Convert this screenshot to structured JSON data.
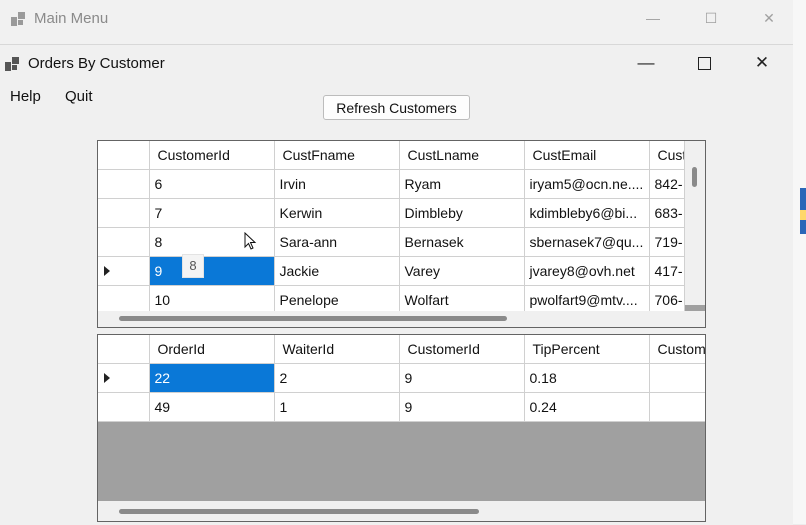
{
  "main_menu_window": {
    "title": "Main Menu"
  },
  "window": {
    "title": "Orders By Customer"
  },
  "menu": [
    "Help",
    "Quit"
  ],
  "refresh_button": "Refresh Customers",
  "customers_grid": {
    "columns": [
      "CustomerId",
      "CustFname",
      "CustLname",
      "CustEmail",
      "Cust"
    ],
    "rows": [
      {
        "id": "6",
        "fname": "Irvin",
        "lname": "Ryam",
        "email": "iryam5@ocn.ne....",
        "phone": "842-"
      },
      {
        "id": "7",
        "fname": "Kerwin",
        "lname": "Dimbleby",
        "email": "kdimbleby6@bi...",
        "phone": "683-"
      },
      {
        "id": "8",
        "fname": "Sara-ann",
        "lname": "Bernasek",
        "email": "sbernasek7@qu...",
        "phone": "719-"
      },
      {
        "id": "9",
        "fname": "Jackie",
        "lname": "Varey",
        "email": "jvarey8@ovh.net",
        "phone": "417-"
      },
      {
        "id": "10",
        "fname": "Penelope",
        "lname": "Wolfart",
        "email": "pwolfart9@mtv....",
        "phone": "706-"
      }
    ],
    "selected_row": 3
  },
  "cell_tooltip": "8",
  "orders_grid": {
    "columns": [
      "OrderId",
      "WaiterId",
      "CustomerId",
      "TipPercent",
      "Custom"
    ],
    "rows": [
      {
        "order_id": "22",
        "waiter_id": "2",
        "customer_id": "9",
        "tip": "0.18",
        "extra": ""
      },
      {
        "order_id": "49",
        "waiter_id": "1",
        "customer_id": "9",
        "tip": "0.24",
        "extra": ""
      }
    ],
    "selected_row": 0
  },
  "colors": {
    "selection": "#0a78d7",
    "grid_background": "#a0a0a0"
  },
  "icons": [
    "app-icon",
    "minimize-icon",
    "maximize-icon",
    "close-icon",
    "row-pointer-icon",
    "mouse-cursor-icon"
  ]
}
